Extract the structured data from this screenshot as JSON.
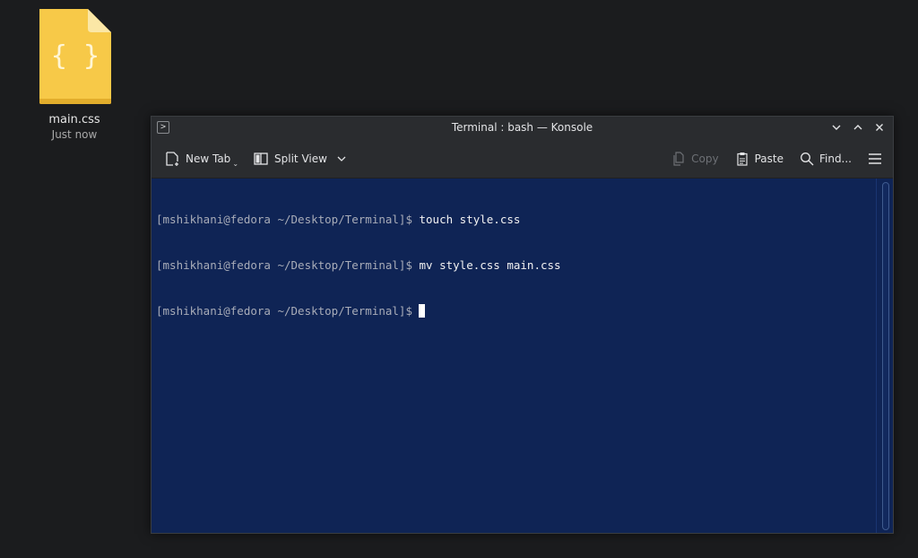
{
  "desktop": {
    "file": {
      "name": "main.css",
      "time": "Just now",
      "glyph": "{ }",
      "icon_color": "#f7c948"
    }
  },
  "window": {
    "title": "Terminal : bash — Konsole",
    "toolbar": {
      "new_tab": "New Tab",
      "split_view": "Split View",
      "copy": "Copy",
      "paste": "Paste",
      "find": "Find..."
    }
  },
  "terminal": {
    "background": "#0f2455",
    "lines": [
      {
        "prompt": "[mshikhani@fedora ~/Desktop/Terminal]",
        "symbol": "$",
        "command": " touch style.css"
      },
      {
        "prompt": "[mshikhani@fedora ~/Desktop/Terminal]",
        "symbol": "$",
        "command": " mv style.css main.css"
      },
      {
        "prompt": "[mshikhani@fedora ~/Desktop/Terminal]",
        "symbol": "$",
        "command": ""
      }
    ]
  }
}
